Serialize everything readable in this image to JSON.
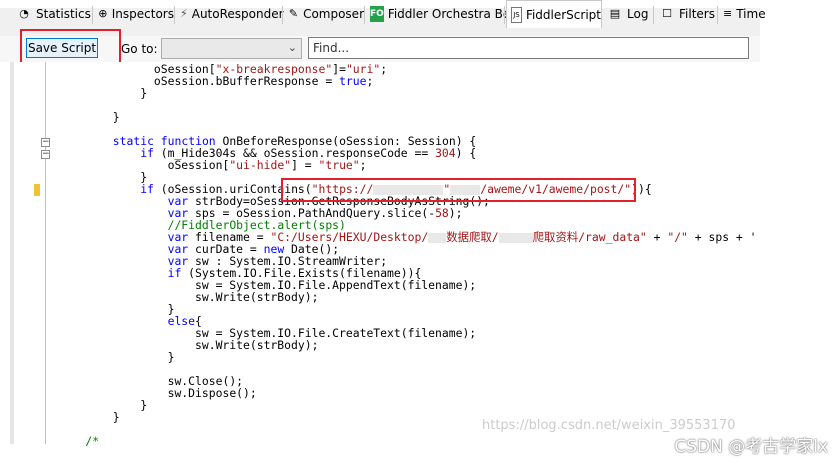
{
  "tabs": [
    {
      "label": "Statistics",
      "icon": "statistics-icon",
      "glyph": "◔"
    },
    {
      "label": "Inspectors",
      "icon": "inspectors-icon",
      "glyph": "⊕"
    },
    {
      "label": "AutoResponder",
      "icon": "lightning-icon",
      "glyph": "⚡"
    },
    {
      "label": "Composer",
      "icon": "composer-icon",
      "glyph": "✎"
    },
    {
      "label": "Fiddler Orchestra Beta",
      "icon": "orchestra-icon",
      "glyph": "FO"
    },
    {
      "label": "FiddlerScript",
      "icon": "script-icon",
      "glyph": "JS"
    },
    {
      "label": "Log",
      "icon": "log-icon",
      "glyph": "▤"
    },
    {
      "label": "Filters",
      "icon": "filters-icon",
      "glyph": "☐"
    },
    {
      "label": "Time",
      "icon": "timeline-icon",
      "glyph": "≡"
    }
  ],
  "toolbar": {
    "save_label": "Save Script",
    "goto_label": "Go to:",
    "goto_value": "",
    "find_placeholder": "Find..."
  },
  "code_lines": [
    {
      "indent": 14,
      "parts": [
        [
          "pl",
          "oSession["
        ],
        [
          "str",
          "\"x-breakresponse\""
        ],
        [
          "pl",
          "]="
        ],
        [
          "str",
          "\"uri\""
        ],
        [
          "pl",
          ";"
        ]
      ]
    },
    {
      "indent": 14,
      "parts": [
        [
          "pl",
          "oSession.bBufferResponse = "
        ],
        [
          "kw",
          "true"
        ],
        [
          "pl",
          ";"
        ]
      ]
    },
    {
      "indent": 12,
      "parts": [
        [
          "pl",
          "}"
        ]
      ]
    },
    {
      "indent": 0,
      "parts": []
    },
    {
      "indent": 8,
      "parts": [
        [
          "pl",
          "}"
        ]
      ]
    },
    {
      "indent": 0,
      "parts": []
    },
    {
      "indent": 8,
      "parts": [
        [
          "kw",
          "static function "
        ],
        [
          "pl",
          "OnBeforeResponse(oSession: Session) {"
        ]
      ]
    },
    {
      "indent": 12,
      "parts": [
        [
          "kw",
          "if "
        ],
        [
          "pl",
          "(m_Hide304s && oSession.responseCode == "
        ],
        [
          "str",
          "304"
        ],
        [
          "pl",
          ") {"
        ]
      ]
    },
    {
      "indent": 16,
      "parts": [
        [
          "pl",
          "oSession["
        ],
        [
          "str",
          "\"ui-hide\""
        ],
        [
          "pl",
          "] = "
        ],
        [
          "str",
          "\"true\""
        ],
        [
          "pl",
          ";"
        ]
      ]
    },
    {
      "indent": 12,
      "parts": [
        [
          "pl",
          "}"
        ]
      ]
    },
    {
      "indent": 12,
      "parts": [
        [
          "kw",
          "if "
        ],
        [
          "pl",
          "(oSession.uriContains("
        ],
        [
          "str",
          "\"https://"
        ],
        [
          "redact",
          ""
        ],
        [
          "str",
          "\""
        ],
        [
          "redact",
          ""
        ],
        [
          "str",
          "/aweme/v1/aweme/post/\""
        ],
        [
          "pl",
          "))"
        ],
        [
          "pl",
          "{"
        ]
      ]
    },
    {
      "indent": 16,
      "parts": [
        [
          "kw",
          "var "
        ],
        [
          "pl",
          "strBody=oSession.GetResponseBodyAsString();"
        ]
      ]
    },
    {
      "indent": 16,
      "parts": [
        [
          "kw",
          "var "
        ],
        [
          "pl",
          "sps = oSession.PathAndQuery.slice(-"
        ],
        [
          "str",
          "58"
        ],
        [
          "pl",
          ");"
        ]
      ]
    },
    {
      "indent": 16,
      "parts": [
        [
          "cm",
          "//FiddlerObject.alert(sps)"
        ]
      ]
    },
    {
      "indent": 16,
      "parts": [
        [
          "kw",
          "var "
        ],
        [
          "pl",
          "filename = "
        ],
        [
          "str",
          "\"C:/Users/HEXU/Desktop/"
        ],
        [
          "redact",
          ""
        ],
        [
          "str",
          "数据爬取/"
        ],
        [
          "redact",
          ""
        ],
        [
          "str",
          "爬取资料/raw_data\""
        ],
        [
          "pl",
          " + "
        ],
        [
          "str",
          "\"/\""
        ],
        [
          "pl",
          " + sps + '"
        ]
      ]
    },
    {
      "indent": 16,
      "parts": [
        [
          "kw",
          "var "
        ],
        [
          "pl",
          "curDate = "
        ],
        [
          "kw",
          "new "
        ],
        [
          "pl",
          "Date();"
        ]
      ]
    },
    {
      "indent": 16,
      "parts": [
        [
          "kw",
          "var "
        ],
        [
          "pl",
          "sw : System.IO.StreamWriter;"
        ]
      ]
    },
    {
      "indent": 16,
      "parts": [
        [
          "kw",
          "if "
        ],
        [
          "pl",
          "(System.IO.File.Exists(filename)){"
        ]
      ]
    },
    {
      "indent": 20,
      "parts": [
        [
          "pl",
          "sw = System.IO.File.AppendText(filename);"
        ]
      ]
    },
    {
      "indent": 20,
      "parts": [
        [
          "pl",
          "sw.Write(strBody);"
        ]
      ]
    },
    {
      "indent": 16,
      "parts": [
        [
          "pl",
          "}"
        ]
      ]
    },
    {
      "indent": 16,
      "parts": [
        [
          "kw",
          "else"
        ],
        [
          "pl",
          "{"
        ]
      ]
    },
    {
      "indent": 20,
      "parts": [
        [
          "pl",
          "sw = System.IO.File.CreateText(filename);"
        ]
      ]
    },
    {
      "indent": 20,
      "parts": [
        [
          "pl",
          "sw.Write(strBody);"
        ]
      ]
    },
    {
      "indent": 16,
      "parts": [
        [
          "pl",
          "}"
        ]
      ]
    },
    {
      "indent": 0,
      "parts": []
    },
    {
      "indent": 16,
      "parts": [
        [
          "pl",
          "sw.Close();"
        ]
      ]
    },
    {
      "indent": 16,
      "parts": [
        [
          "pl",
          "sw.Dispose();"
        ]
      ]
    },
    {
      "indent": 12,
      "parts": [
        [
          "pl",
          "}"
        ]
      ]
    },
    {
      "indent": 8,
      "parts": [
        [
          "pl",
          "}"
        ]
      ]
    },
    {
      "indent": 0,
      "parts": []
    },
    {
      "indent": 4,
      "parts": [
        [
          "cm",
          "/*"
        ]
      ]
    }
  ],
  "watermark": "https://blog.csdn.net/weixin_39553170",
  "csdn_tag": "CSDN @考古学家lx",
  "colors": {
    "highlight": "#e0202a",
    "keyword": "#0000ff",
    "string": "#a31515",
    "comment": "#008000"
  }
}
